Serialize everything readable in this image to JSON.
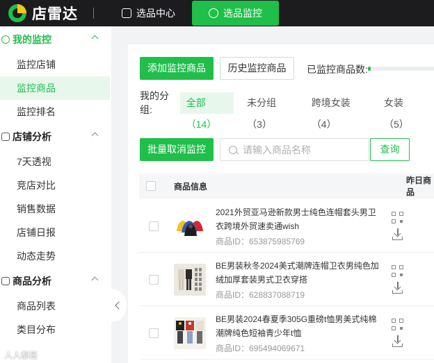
{
  "topbar": {
    "brand": "店雷达",
    "nav": [
      {
        "label": "选品中心",
        "icon": "shop-bag-icon"
      },
      {
        "label": "选品监控",
        "icon": "monitor-icon"
      }
    ]
  },
  "sidebar": {
    "sections": [
      {
        "label": "我的监控",
        "icon": "monitor-icon",
        "items": [
          "监控店铺",
          "监控商品",
          "监控排名"
        ]
      },
      {
        "label": "店铺分析",
        "icon": "store-icon",
        "items": [
          "7天透视",
          "竞店对比",
          "销售数据",
          "店铺日报",
          "动态走势"
        ]
      },
      {
        "label": "商品分析",
        "icon": "goods-icon",
        "items": [
          "商品列表",
          "类目分布"
        ]
      }
    ]
  },
  "main": {
    "add_button": "添加监控商品",
    "history_button": "历史监控商品",
    "count_label": "已监控商品数:",
    "count_fraction": 0.03,
    "groups_label": "我的分组:",
    "groups": [
      "全部（14）",
      "未分组（3）",
      "跨境女装（4）",
      "女装（5）"
    ],
    "batch_cancel_button": "批量取消监控",
    "search_placeholder": "请输入商品名称",
    "query_button": "查询",
    "table_headers": [
      "商品信息",
      "昨日商品"
    ],
    "rows": [
      {
        "title": "2021外贸亚马逊新款男士纯色连帽套头男卫衣跨境外贸速卖通wish",
        "id": "商品ID：653875985769"
      },
      {
        "title": "BE男装秋冬2024美式潮牌连帽卫衣男纯色加绒加厚套装男式卫衣穿搭",
        "id": "商品ID：628837088719"
      },
      {
        "title": "BE男装2024春夏季305G重磅t恤男美式纯棉潮牌纯色短袖青少年t恤",
        "id": "商品ID：695494069671"
      }
    ]
  },
  "watermark": "人人都是"
}
